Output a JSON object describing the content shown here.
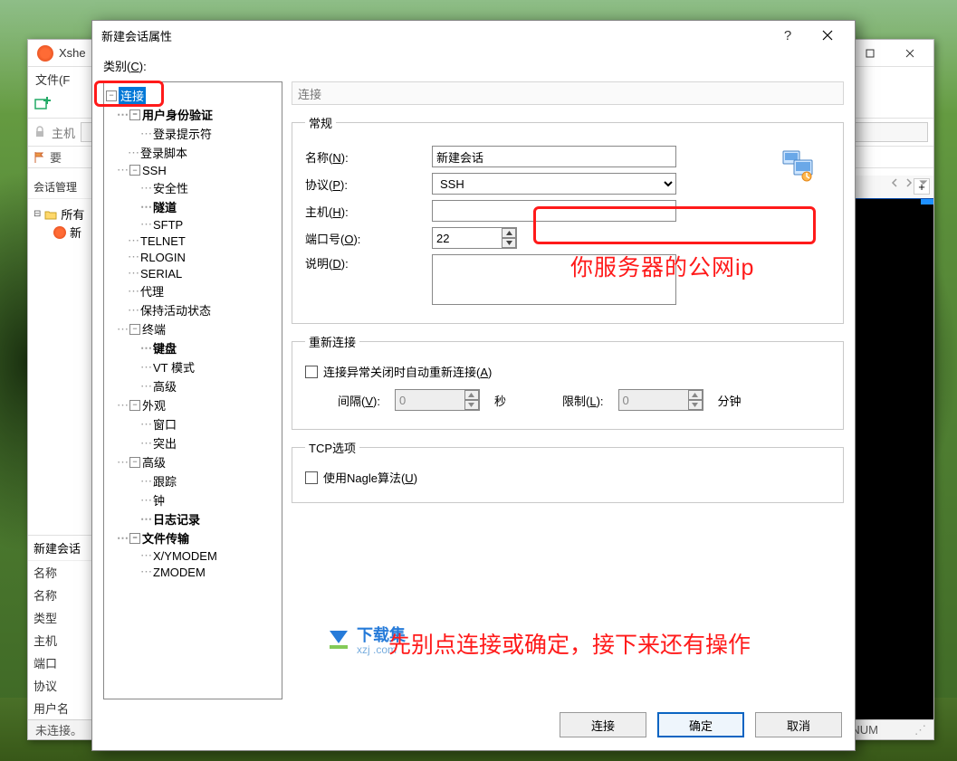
{
  "xshell": {
    "title": "Xshe",
    "menubar": "文件(F",
    "hostbar_label": "主机",
    "plugin_label": "要",
    "session_mgr": "会话管理",
    "tree_root": "所有",
    "tree_sess": "新",
    "detail_header": "新建会话",
    "details": [
      "名称",
      "名称",
      "类型",
      "主机",
      "端口",
      "协议",
      "用户名"
    ],
    "status_left": "未连接。",
    "status_num": "NUM"
  },
  "dialog": {
    "title": "新建会话属性",
    "category_label": "类别(C):",
    "section_title": "连接",
    "tree": {
      "connection": "连接",
      "auth": "用户身份验证",
      "prompt": "登录提示符",
      "script": "登录脚本",
      "ssh": "SSH",
      "security": "安全性",
      "tunnel": "隧道",
      "sftp": "SFTP",
      "telnet": "TELNET",
      "rlogin": "RLOGIN",
      "serial": "SERIAL",
      "proxy": "代理",
      "keepalive": "保持活动状态",
      "terminal": "终端",
      "keyboard": "键盘",
      "vt": "VT 模式",
      "advanced_t": "高级",
      "appearance": "外观",
      "window": "窗口",
      "highlight": "突出",
      "advanced": "高级",
      "trace": "跟踪",
      "bell": "钟",
      "log": "日志记录",
      "filetransfer": "文件传输",
      "xymodem": "X/YMODEM",
      "zmodem": "ZMODEM"
    },
    "general": {
      "legend": "常规",
      "name_label": "名称(N):",
      "name_value": "新建会话",
      "proto_label": "协议(P):",
      "proto_value": "SSH",
      "host_label": "主机(H):",
      "host_value": "",
      "port_label": "端口号(O):",
      "port_value": "22",
      "desc_label": "说明(D):",
      "desc_value": ""
    },
    "reconnect": {
      "legend": "重新连接",
      "chk_label": "连接异常关闭时自动重新连接(A)",
      "interval_label": "间隔(V):",
      "interval_value": "0",
      "interval_unit": "秒",
      "limit_label": "限制(L):",
      "limit_value": "0",
      "limit_unit": "分钟"
    },
    "tcp": {
      "legend": "TCP选项",
      "nagle_label": "使用Nagle算法(U)"
    },
    "buttons": {
      "connect": "连接",
      "ok": "确定",
      "cancel": "取消"
    }
  },
  "annotations": {
    "host_hint": "你服务器的公网ip",
    "bottom_hint": "先别点连接或确定，接下来还有操作"
  },
  "watermark": {
    "line1": "下载集",
    "line2": "xzj .com"
  }
}
